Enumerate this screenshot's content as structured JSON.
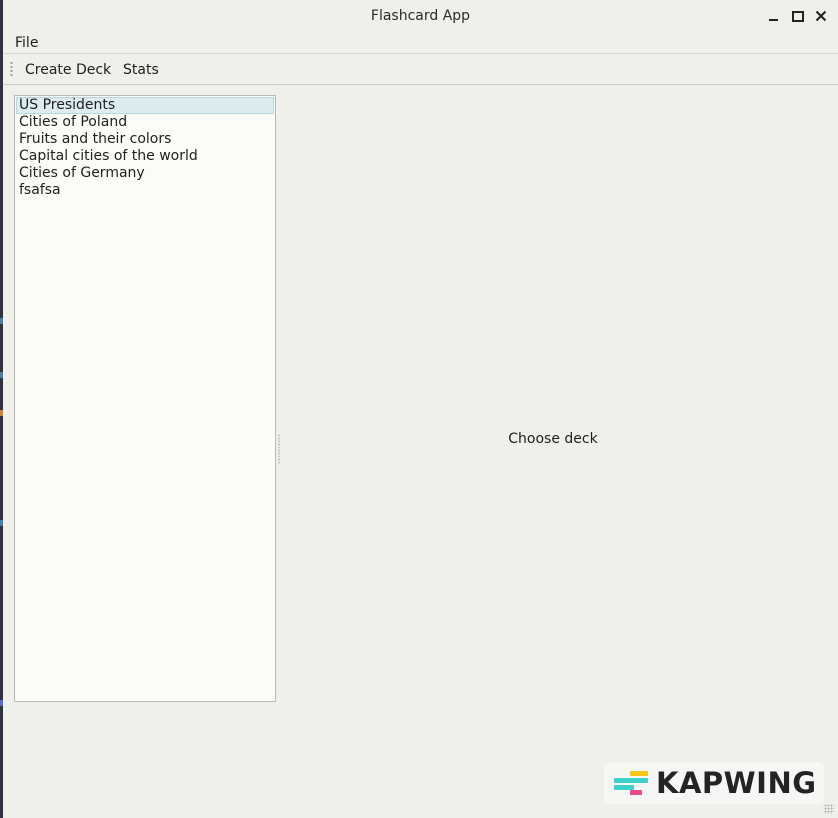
{
  "window": {
    "title": "Flashcard App"
  },
  "menubar": {
    "file_label": "File"
  },
  "toolbar": {
    "create_deck_label": "Create Deck",
    "stats_label": "Stats"
  },
  "decks": {
    "selected_index": 0,
    "items": [
      {
        "label": "US Presidents"
      },
      {
        "label": "Cities of Poland"
      },
      {
        "label": "Fruits and their colors"
      },
      {
        "label": "Capital cities of the world"
      },
      {
        "label": "Cities of Germany"
      },
      {
        "label": "fsafsa"
      }
    ]
  },
  "main": {
    "placeholder": "Choose deck"
  },
  "watermark": {
    "text": "KAPWING",
    "colors": [
      "#f5c518",
      "#3fd1c9",
      "#e94b8a"
    ]
  },
  "icons": {
    "minimize": "minimize-icon",
    "maximize": "maximize-icon",
    "close": "close-icon"
  }
}
